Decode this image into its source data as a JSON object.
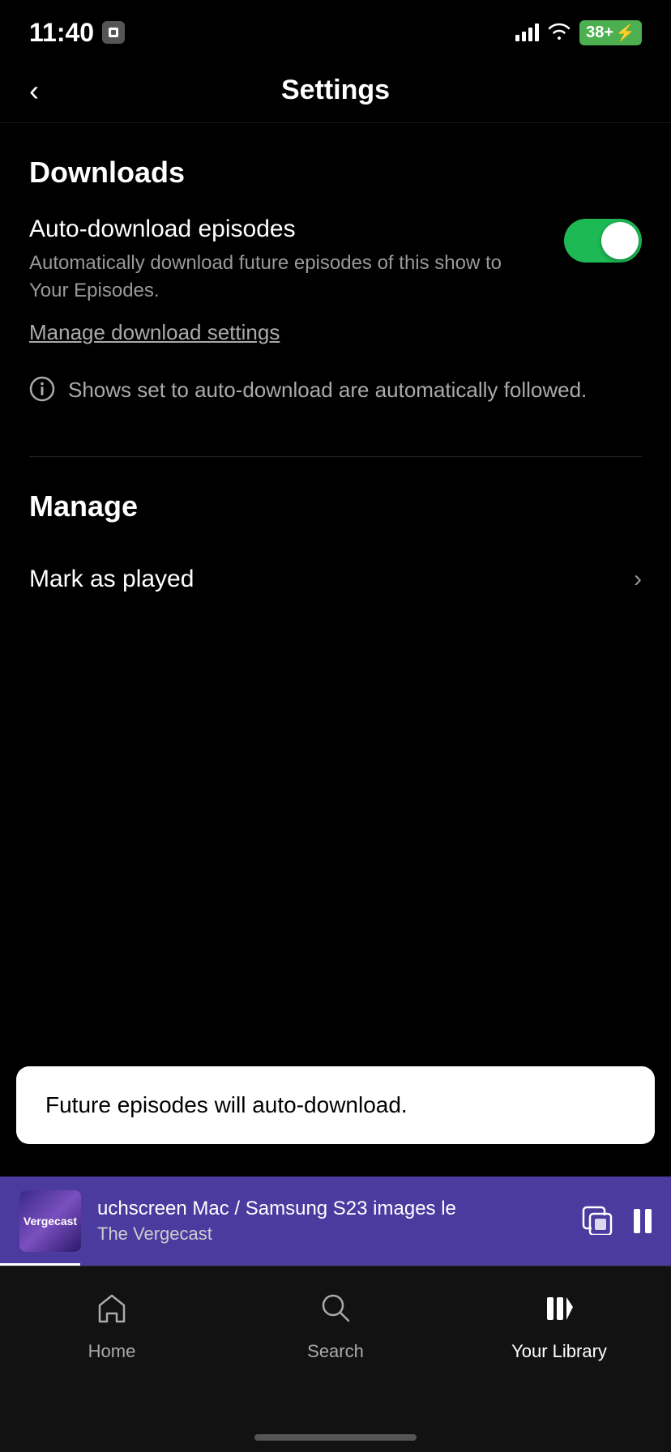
{
  "statusBar": {
    "time": "11:40",
    "batteryLevel": "38+",
    "batteryIcon": "⚡"
  },
  "header": {
    "title": "Settings",
    "backLabel": "‹"
  },
  "downloads": {
    "sectionTitle": "Downloads",
    "autoDownloadLabel": "Auto-download episodes",
    "autoDownloadDescription": "Automatically download future episodes of this show to Your Episodes.",
    "manageLink": "Manage download settings",
    "infoNote": "Shows set to auto-download are automatically followed.",
    "toggleOn": true
  },
  "manage": {
    "sectionTitle": "Manage",
    "markAsPlayedLabel": "Mark as played"
  },
  "toast": {
    "text": "Future episodes will auto-download."
  },
  "nowPlaying": {
    "title": "uchscreen Mac / Samsung S23 images le",
    "show": "The Vergecast",
    "artLabel": "Vergecast"
  },
  "bottomNav": {
    "items": [
      {
        "label": "Home",
        "icon": "home"
      },
      {
        "label": "Search",
        "icon": "search"
      },
      {
        "label": "Your Library",
        "icon": "library"
      }
    ]
  }
}
